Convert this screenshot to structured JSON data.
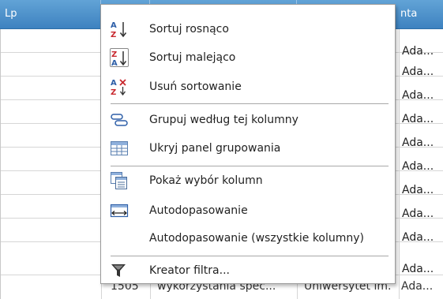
{
  "grid": {
    "columns": [
      "Lp",
      "",
      "",
      "nta"
    ],
    "rows": [
      "Ada...",
      "Ada...",
      "Ada...",
      "Ada...",
      "Ada...",
      "Ada...",
      "Ada...",
      "Ada...",
      "Ada...",
      "Ada...",
      "Ada..."
    ],
    "bottom_row": {
      "lp": "1505",
      "col3": "wykorzystania spec...",
      "col4": "Uniwersytet im.",
      "col5": "Ada..."
    }
  },
  "context_menu": {
    "items": [
      {
        "label": "Sortuj rosnąco",
        "icon": "sort-ascending-icon"
      },
      {
        "label": "Sortuj malejąco",
        "icon": "sort-descending-icon"
      },
      {
        "label": "Usuń sortowanie",
        "icon": "clear-sorting-icon"
      },
      {
        "label": "Grupuj według tej kolumny",
        "icon": "group-by-column-icon"
      },
      {
        "label": "Ukryj panel grupowania",
        "icon": "group-panel-icon"
      },
      {
        "label": "Pokaż wybór kolumn",
        "icon": "column-chooser-icon"
      },
      {
        "label": "Autodopasowanie",
        "icon": "best-fit-icon"
      },
      {
        "label": "Autodopasowanie (wszystkie kolumny)",
        "icon": ""
      },
      {
        "label": "Kreator filtra...",
        "icon": "filter-icon"
      }
    ]
  },
  "colors": {
    "header_blue": "#4a8fcc",
    "icon_blue": "#2e5fa8",
    "icon_red": "#c8282e"
  }
}
